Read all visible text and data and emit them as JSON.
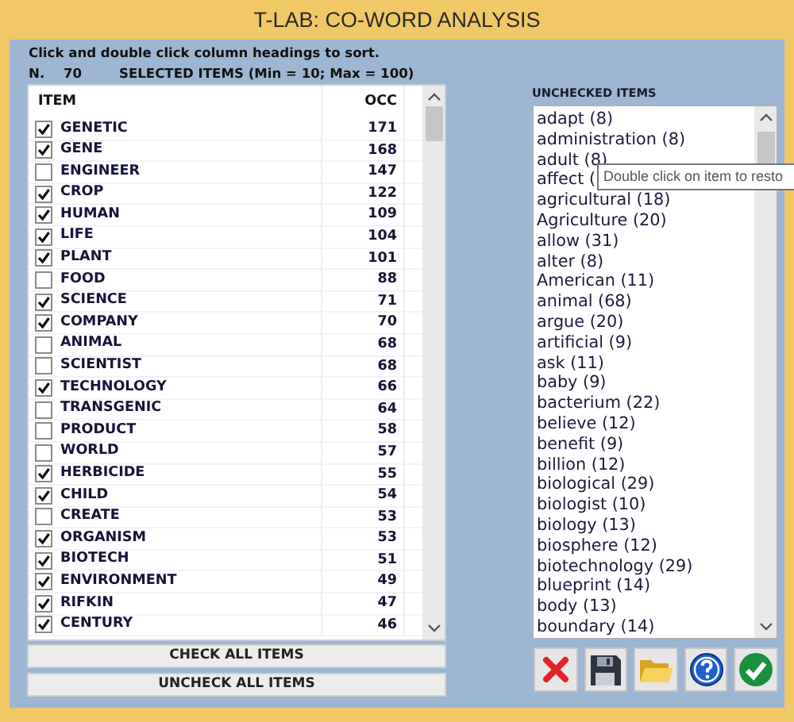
{
  "window": {
    "title": "T-LAB: CO-WORD ANALYSIS"
  },
  "hint": "Click and double click column headings to sort.",
  "count": {
    "label": "N.",
    "value": "70",
    "caption": "SELECTED ITEMS (Min = 10; Max = 100)"
  },
  "table": {
    "columns": [
      "ITEM",
      "OCC"
    ],
    "rows": [
      {
        "item": "GENETIC",
        "occ": "171",
        "checked": true
      },
      {
        "item": "GENE",
        "occ": "168",
        "checked": true
      },
      {
        "item": "ENGINEER",
        "occ": "147",
        "checked": false
      },
      {
        "item": "CROP",
        "occ": "122",
        "checked": true
      },
      {
        "item": "HUMAN",
        "occ": "109",
        "checked": true
      },
      {
        "item": "LIFE",
        "occ": "104",
        "checked": true
      },
      {
        "item": "PLANT",
        "occ": "101",
        "checked": true
      },
      {
        "item": "FOOD",
        "occ": "88",
        "checked": false
      },
      {
        "item": "SCIENCE",
        "occ": "71",
        "checked": true
      },
      {
        "item": "COMPANY",
        "occ": "70",
        "checked": true
      },
      {
        "item": "ANIMAL",
        "occ": "68",
        "checked": false
      },
      {
        "item": "SCIENTIST",
        "occ": "68",
        "checked": false
      },
      {
        "item": "TECHNOLOGY",
        "occ": "66",
        "checked": true
      },
      {
        "item": "TRANSGENIC",
        "occ": "64",
        "checked": false
      },
      {
        "item": "PRODUCT",
        "occ": "58",
        "checked": false
      },
      {
        "item": "WORLD",
        "occ": "57",
        "checked": false
      },
      {
        "item": "HERBICIDE",
        "occ": "55",
        "checked": true
      },
      {
        "item": "CHILD",
        "occ": "54",
        "checked": true
      },
      {
        "item": "CREATE",
        "occ": "53",
        "checked": false
      },
      {
        "item": "ORGANISM",
        "occ": "53",
        "checked": true
      },
      {
        "item": "BIOTECH",
        "occ": "51",
        "checked": true
      },
      {
        "item": "ENVIRONMENT",
        "occ": "49",
        "checked": true
      },
      {
        "item": "RIFKIN",
        "occ": "47",
        "checked": true
      },
      {
        "item": "CENTURY",
        "occ": "46",
        "checked": true
      }
    ]
  },
  "buttons": [
    "CHECK ALL ITEMS",
    "UNCHECK ALL ITEMS"
  ],
  "unchecked": {
    "label": "UNCHECKED ITEMS",
    "items": [
      "adapt (8)",
      "administration (8)",
      "adult (8)",
      "affect (",
      "agricultural (18)",
      "Agriculture (20)",
      "allow (31)",
      "alter (8)",
      "American (11)",
      "animal (68)",
      "argue (20)",
      "artificial (9)",
      "ask (11)",
      "baby (9)",
      "bacterium (22)",
      "believe (12)",
      "benefit (9)",
      "billion (12)",
      "biological (29)",
      "biologist (10)",
      "biology (13)",
      "biosphere (12)",
      "biotechnology (29)",
      "blueprint (14)",
      "body (13)",
      "boundary (14)"
    ]
  },
  "tooltip": "Double click on item to resto",
  "toolbar": [
    {
      "kind": "delete"
    },
    {
      "kind": "save"
    },
    {
      "kind": "open"
    },
    {
      "kind": "help"
    },
    {
      "kind": "ok"
    }
  ]
}
